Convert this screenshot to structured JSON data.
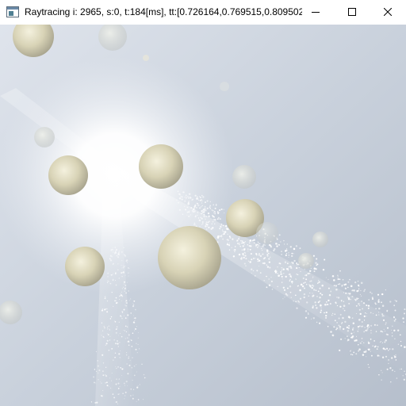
{
  "window": {
    "title": "Raytracing i: 2965, s:0, t:184[ms], tt:[0.726164,0.769515,0.809502]...",
    "icon": "app-window-icon",
    "controls": {
      "minimize_icon": "minimize-icon",
      "maximize_icon": "maximize-icon",
      "close_icon": "close-icon"
    }
  },
  "scene": {
    "background_colors": [
      "#e9edf3",
      "#c9d1dc",
      "#b7c0cd"
    ],
    "sphere_color": "#d6d2b8",
    "light_color": "#ffffff"
  }
}
